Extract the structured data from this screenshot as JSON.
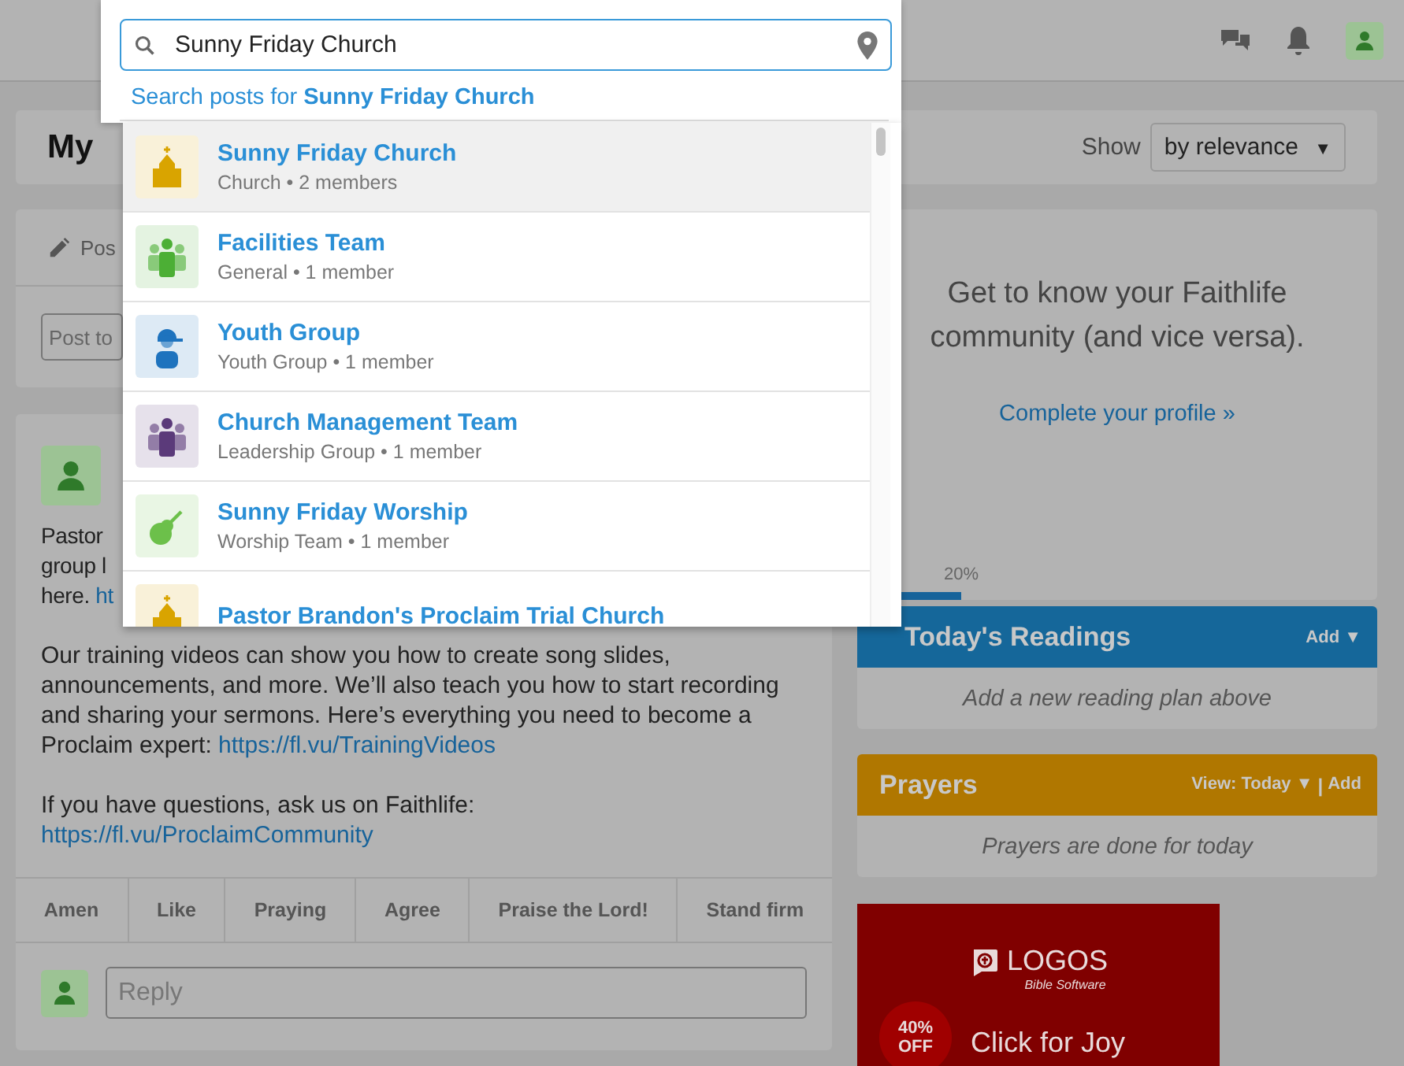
{
  "page_header": {
    "title": "My",
    "show_label": "Show",
    "sort": "by relevance",
    "sort_caret": "▼"
  },
  "composer": {
    "tab": "Pos",
    "placeholder": "Post to"
  },
  "post": {
    "lines": [
      "Pastor",
      "group l"
    ],
    "partial_link_prefix": "here.",
    "partial_link": "ht",
    "paragraphs": [
      {
        "text": "Our training videos can show you how to create song slides, announcements, and more. We’ll also teach you how to start recording and sharing your sermons. Here’s everything you need to become a Proclaim expert:",
        "link": "https://fl.vu/TrainingVideos"
      },
      {
        "text": "If you have questions, ask us on Faithlife:",
        "link": "https://fl.vu/ProclaimCommunity"
      }
    ],
    "reactions": [
      "Amen",
      "Like",
      "Praying",
      "Agree",
      "Praise the Lord!",
      "Stand firm"
    ],
    "reply_placeholder": "Reply"
  },
  "profile_card": {
    "text": "Get to know your Faithlife community (and vice versa).",
    "link": "Complete your profile »",
    "progress": {
      "level": 0.2,
      "label": "20%"
    }
  },
  "readings": {
    "title": "Today's Readings",
    "action": "Add ▼",
    "empty": "Add a new reading plan above"
  },
  "prayers": {
    "title": "Prayers",
    "view": "View: Today ▼",
    "separator": "|",
    "action": "Add",
    "empty": "Prayers are done for today"
  },
  "ad": {
    "brand": "LOGOS",
    "tagline": "Bible Software",
    "badge": "40% OFF",
    "headline": "Click for Joy"
  },
  "search": {
    "value": "Sunny Friday Church",
    "posts_prefix": "Search posts for ",
    "posts_query": "Sunny Friday Church",
    "results": [
      {
        "kind": "church",
        "color": "#d9a400",
        "name": "Sunny Friday Church",
        "meta": "Church • 2 members",
        "selected": true
      },
      {
        "kind": "group",
        "color": "#4caf35",
        "name": "Facilities Team",
        "meta": "General • 1 member",
        "selected": false
      },
      {
        "kind": "youth",
        "color": "#1e73be",
        "name": "Youth Group",
        "meta": "Youth Group • 1 member",
        "selected": false
      },
      {
        "kind": "group",
        "color": "#5b3a7a",
        "name": "Church Management Team",
        "meta": "Leadership Group • 1 member",
        "selected": false
      },
      {
        "kind": "guitar",
        "color": "#6cc04a",
        "name": "Sunny Friday Worship",
        "meta": "Worship Team • 1 member",
        "selected": false
      },
      {
        "kind": "church",
        "color": "#d9a400",
        "name": "Pastor Brandon's Proclaim Trial Church",
        "selected": false
      }
    ]
  }
}
